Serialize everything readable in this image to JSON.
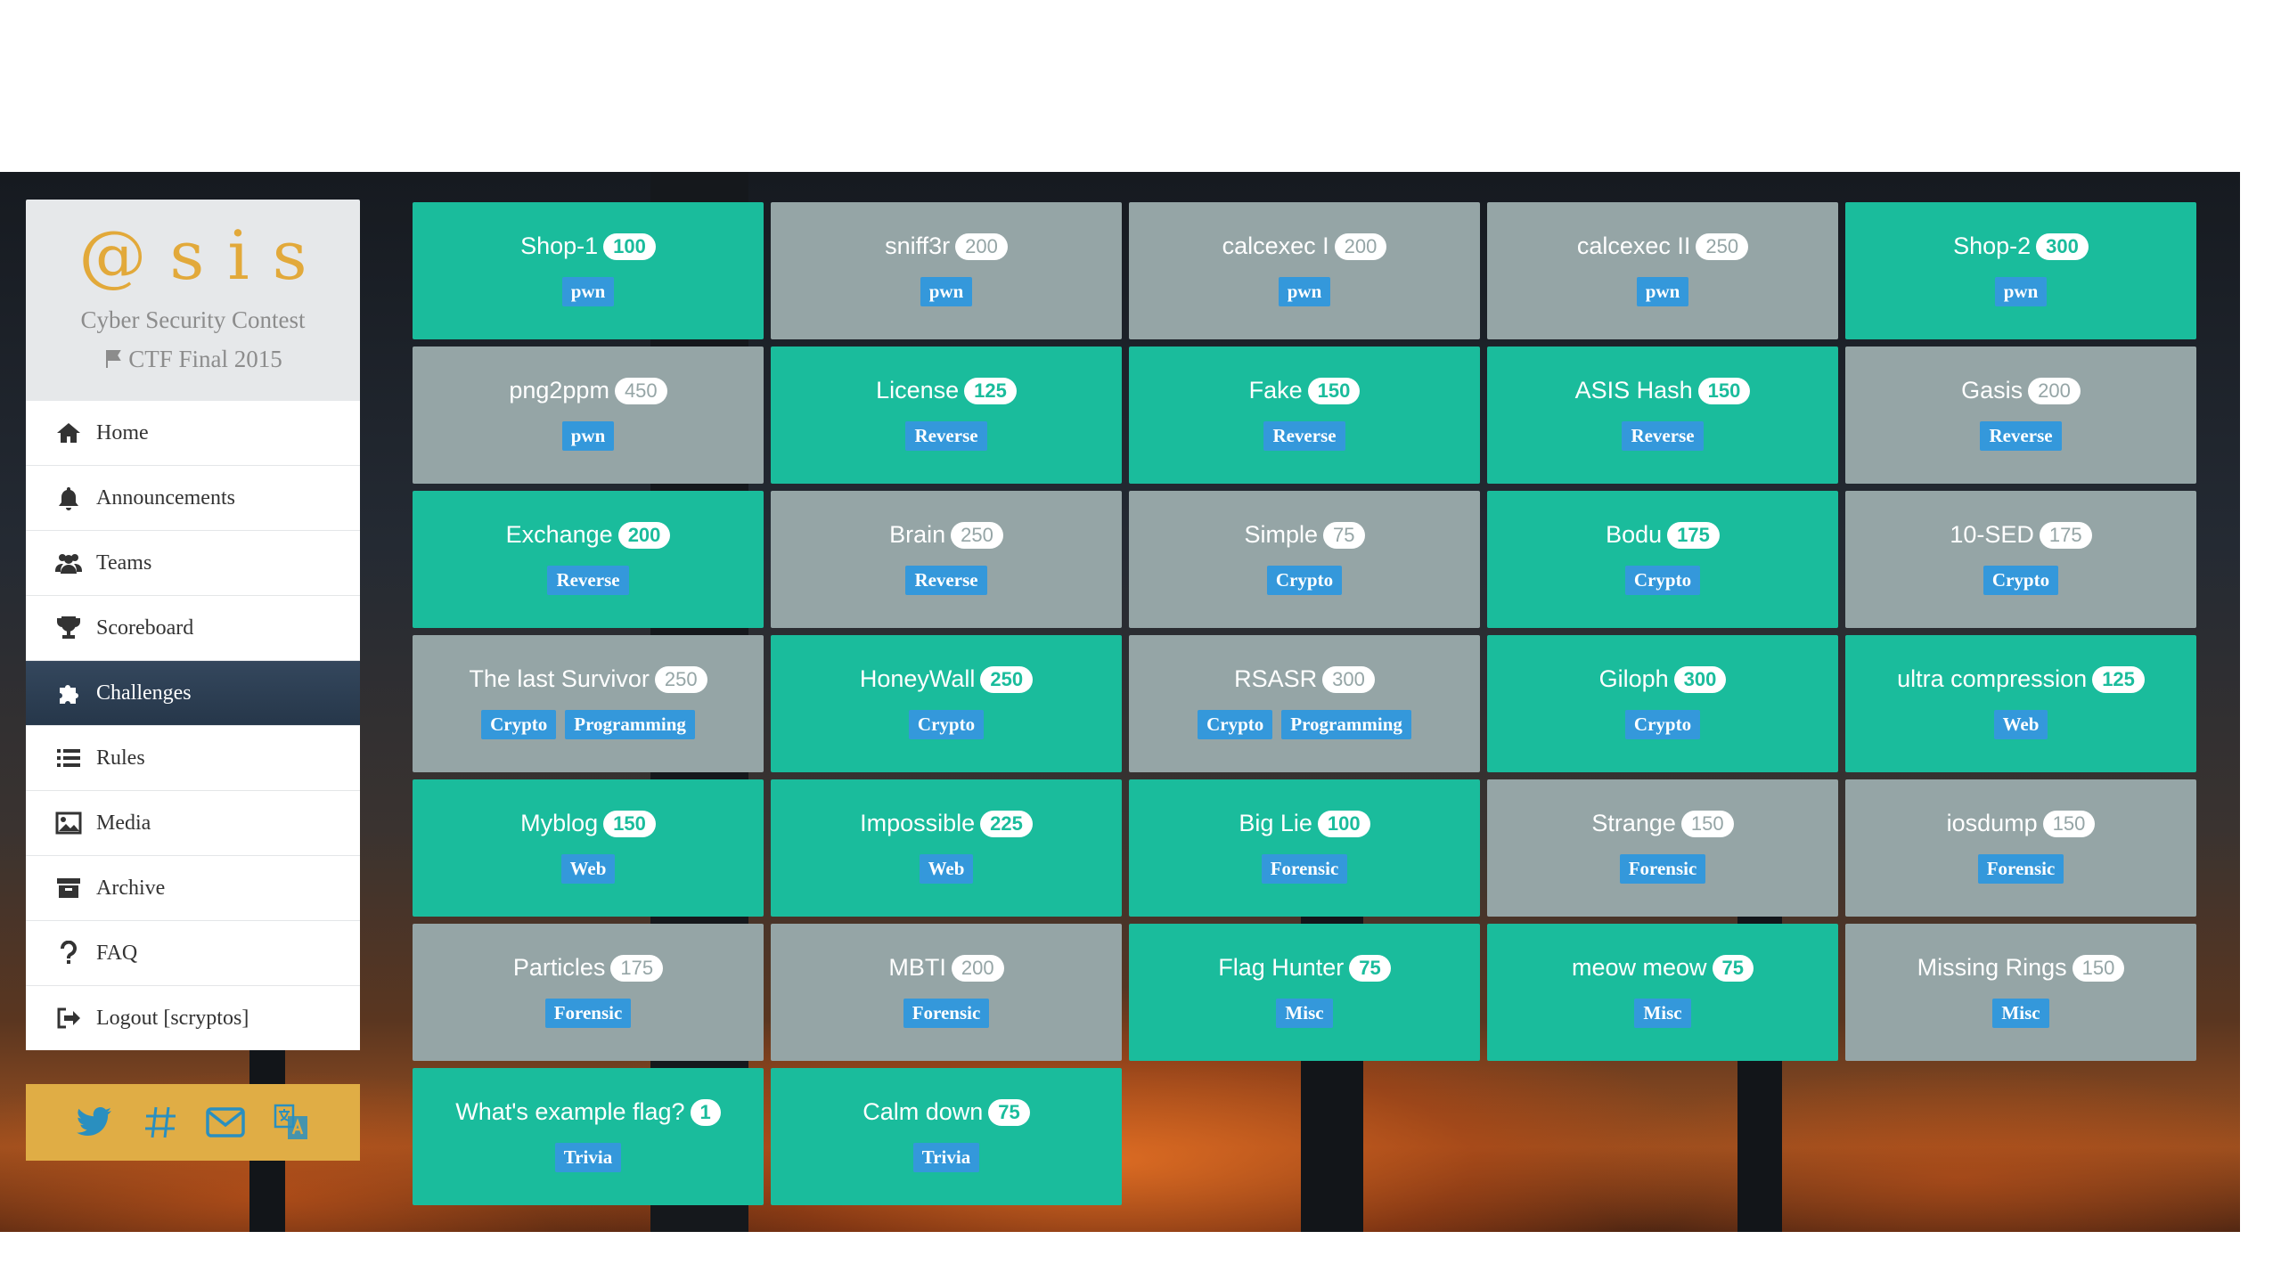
{
  "brand": {
    "logo_text": "@sis",
    "subtitle": "Cyber Security Contest",
    "edition": "CTF Final 2015"
  },
  "menu": [
    {
      "label": "Home",
      "icon": "home-icon"
    },
    {
      "label": "Announcements",
      "icon": "bell-icon"
    },
    {
      "label": "Teams",
      "icon": "users-icon"
    },
    {
      "label": "Scoreboard",
      "icon": "trophy-icon"
    },
    {
      "label": "Challenges",
      "icon": "puzzle-icon",
      "active": true
    },
    {
      "label": "Rules",
      "icon": "list-icon"
    },
    {
      "label": "Media",
      "icon": "image-icon"
    },
    {
      "label": "Archive",
      "icon": "archive-icon"
    },
    {
      "label": "FAQ",
      "icon": "question-icon"
    },
    {
      "label": "Logout [scryptos]",
      "icon": "sign-out-icon"
    }
  ],
  "social": [
    "twitter-icon",
    "hashtag-icon",
    "envelope-icon",
    "translate-icon"
  ],
  "colors": {
    "open": "#1abc9c",
    "solved": "#95a5a6",
    "tag": "#3498db",
    "sidebar_active": "#2c3e50",
    "social_bar": "#e0ad45",
    "logo": "#e2a93a"
  },
  "challenges": [
    {
      "name": "Shop-1",
      "points": "100",
      "status": "open",
      "tags": [
        "pwn"
      ]
    },
    {
      "name": "sniff3r",
      "points": "200",
      "status": "solved",
      "tags": [
        "pwn"
      ]
    },
    {
      "name": "calcexec I",
      "points": "200",
      "status": "solved",
      "tags": [
        "pwn"
      ]
    },
    {
      "name": "calcexec II",
      "points": "250",
      "status": "solved",
      "tags": [
        "pwn"
      ]
    },
    {
      "name": "Shop-2",
      "points": "300",
      "status": "open",
      "tags": [
        "pwn"
      ]
    },
    {
      "name": "png2ppm",
      "points": "450",
      "status": "solved",
      "tags": [
        "pwn"
      ]
    },
    {
      "name": "License",
      "points": "125",
      "status": "open",
      "tags": [
        "Reverse"
      ]
    },
    {
      "name": "Fake",
      "points": "150",
      "status": "open",
      "tags": [
        "Reverse"
      ]
    },
    {
      "name": "ASIS Hash",
      "points": "150",
      "status": "open",
      "tags": [
        "Reverse"
      ]
    },
    {
      "name": "Gasis",
      "points": "200",
      "status": "solved",
      "tags": [
        "Reverse"
      ]
    },
    {
      "name": "Exchange",
      "points": "200",
      "status": "open",
      "tags": [
        "Reverse"
      ]
    },
    {
      "name": "Brain",
      "points": "250",
      "status": "solved",
      "tags": [
        "Reverse"
      ]
    },
    {
      "name": "Simple",
      "points": "75",
      "status": "solved",
      "tags": [
        "Crypto"
      ]
    },
    {
      "name": "Bodu",
      "points": "175",
      "status": "open",
      "tags": [
        "Crypto"
      ]
    },
    {
      "name": "10-SED",
      "points": "175",
      "status": "solved",
      "tags": [
        "Crypto"
      ]
    },
    {
      "name": "The last Survivor",
      "points": "250",
      "status": "solved",
      "tags": [
        "Crypto",
        "Programming"
      ]
    },
    {
      "name": "HoneyWall",
      "points": "250",
      "status": "open",
      "tags": [
        "Crypto"
      ]
    },
    {
      "name": "RSASR",
      "points": "300",
      "status": "solved",
      "tags": [
        "Crypto",
        "Programming"
      ]
    },
    {
      "name": "Giloph",
      "points": "300",
      "status": "open",
      "tags": [
        "Crypto"
      ]
    },
    {
      "name": "ultra compression",
      "points": "125",
      "status": "open",
      "tags": [
        "Web"
      ]
    },
    {
      "name": "Myblog",
      "points": "150",
      "status": "open",
      "tags": [
        "Web"
      ]
    },
    {
      "name": "Impossible",
      "points": "225",
      "status": "open",
      "tags": [
        "Web"
      ]
    },
    {
      "name": "Big Lie",
      "points": "100",
      "status": "open",
      "tags": [
        "Forensic"
      ]
    },
    {
      "name": "Strange",
      "points": "150",
      "status": "solved",
      "tags": [
        "Forensic"
      ]
    },
    {
      "name": "iosdump",
      "points": "150",
      "status": "solved",
      "tags": [
        "Forensic"
      ]
    },
    {
      "name": "Particles",
      "points": "175",
      "status": "solved",
      "tags": [
        "Forensic"
      ]
    },
    {
      "name": "MBTI",
      "points": "200",
      "status": "solved",
      "tags": [
        "Forensic"
      ]
    },
    {
      "name": "Flag Hunter",
      "points": "75",
      "status": "open",
      "tags": [
        "Misc"
      ]
    },
    {
      "name": "meow meow",
      "points": "75",
      "status": "open",
      "tags": [
        "Misc"
      ]
    },
    {
      "name": "Missing Rings",
      "points": "150",
      "status": "solved",
      "tags": [
        "Misc"
      ]
    },
    {
      "name": "What's example flag?",
      "points": "1",
      "status": "open",
      "tags": [
        "Trivia"
      ]
    },
    {
      "name": "Calm down",
      "points": "75",
      "status": "open",
      "tags": [
        "Trivia"
      ]
    }
  ]
}
